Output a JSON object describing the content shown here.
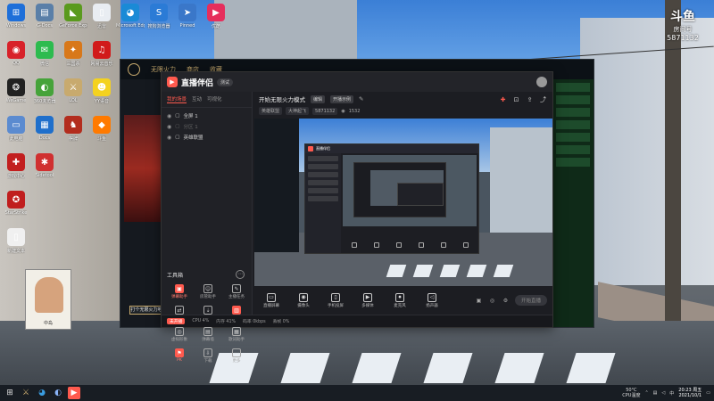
{
  "desktop": {
    "icons_col": [
      {
        "label": "Windows",
        "icon": "windows-icon",
        "color": "#1e6fd9",
        "glyph": "⊞"
      },
      {
        "label": "G-Docs",
        "icon": "docs-icon",
        "color": "#5a7fa8",
        "glyph": "▤"
      },
      {
        "label": "GeForce Experience",
        "icon": "nvidia-icon",
        "color": "#5a9a1e",
        "glyph": "◣"
      },
      {
        "label": "迅雷",
        "icon": "file-icon",
        "color": "#e9edf2",
        "glyph": "▯"
      },
      {
        "label": "QQ",
        "icon": "qq-icon",
        "color": "#d8222a",
        "glyph": "◉"
      },
      {
        "label": "微信",
        "icon": "wechat-icon",
        "color": "#2dbb4f",
        "glyph": "✉"
      },
      {
        "label": "三国杀",
        "icon": "game-icon",
        "color": "#d8781a",
        "glyph": "✦"
      },
      {
        "label": "网易云音乐",
        "icon": "music-icon",
        "color": "#d11a1a",
        "glyph": "♫"
      },
      {
        "label": "WeGame",
        "icon": "wegame-icon",
        "color": "#222",
        "glyph": "❂"
      },
      {
        "label": "360浏览器",
        "icon": "browser-icon",
        "color": "#46a33a",
        "glyph": "◐"
      },
      {
        "label": "LOL",
        "icon": "lol-icon",
        "color": "#c8aa6e",
        "glyph": "⚔"
      },
      {
        "label": "YY语音",
        "icon": "yy-icon",
        "color": "#f4d21f",
        "glyph": "☻"
      },
      {
        "label": "此电脑",
        "icon": "pc-icon",
        "color": "#5b8bd0",
        "glyph": "▭"
      },
      {
        "label": "Docs",
        "icon": "docs2-icon",
        "color": "#1f6fcb",
        "glyph": "▦"
      },
      {
        "label": "棋牌",
        "icon": "chess-icon",
        "color": "#b32d1e",
        "glyph": "♞"
      },
      {
        "label": "斗鱼",
        "icon": "douyu-icon",
        "color": "#ff7a00",
        "glyph": "◆"
      },
      {
        "label": "游戏中心",
        "icon": "gamecenter-icon",
        "color": "#c21f1f",
        "glyph": "✚"
      },
      {
        "label": "Sidetool",
        "icon": "tool-icon",
        "color": "#d03030",
        "glyph": "✱"
      },
      {
        "label": "",
        "icon": "blank-icon",
        "color": "transparent",
        "glyph": ""
      },
      {
        "label": "",
        "icon": "blank-icon",
        "color": "transparent",
        "glyph": ""
      },
      {
        "label": "StarStrike",
        "icon": "star-icon",
        "color": "#c01e1e",
        "glyph": "✪"
      },
      {
        "label": "",
        "icon": "blank-icon",
        "color": "transparent",
        "glyph": ""
      },
      {
        "label": "",
        "icon": "blank-icon",
        "color": "transparent",
        "glyph": ""
      },
      {
        "label": "",
        "icon": "blank-icon",
        "color": "transparent",
        "glyph": ""
      },
      {
        "label": "新建文本",
        "icon": "text-file-icon",
        "color": "#f0f0f0",
        "glyph": "▯"
      }
    ],
    "icons_top": [
      {
        "label": "Microsoft Edge",
        "icon": "edge-icon",
        "color": "#1a8ad6",
        "glyph": "◕"
      },
      {
        "label": "搜狗浏览器",
        "icon": "sogou-icon",
        "color": "#2b7bd6",
        "glyph": "S"
      },
      {
        "label": "Pinned",
        "icon": "pin-icon",
        "color": "#3a77c9",
        "glyph": "➤"
      },
      {
        "label": "优酷",
        "icon": "youku-icon",
        "color": "#e62e5c",
        "glyph": "▶"
      }
    ],
    "badge": {
      "title": "斗鱼",
      "subtitle": "房间号",
      "room": "5871132"
    },
    "poster_text": "中岛"
  },
  "game_client": {
    "top_items": [
      "无限火力",
      "商店",
      "收藏"
    ],
    "play_button": "打个无限火力吧"
  },
  "app": {
    "title": "直播伴侣",
    "version": "测试",
    "colors": {
      "accent": "#ff5a4e"
    },
    "scene_tabs": [
      "我的场景",
      "互动",
      "可视化"
    ],
    "scenes": [
      {
        "label": "全屏 1",
        "dim": false
      },
      {
        "label": "分区 1",
        "dim": true
      },
      {
        "label": "英雄联盟",
        "dim": false
      }
    ],
    "toolbox_title": "工具箱",
    "tools": [
      {
        "label": "弹幕助手",
        "icon": "danmu-icon",
        "glyph": "▣",
        "hot": true
      },
      {
        "label": "房管助手",
        "icon": "admin-icon",
        "glyph": "☺",
        "hot": false
      },
      {
        "label": "主播任务",
        "icon": "task-icon",
        "glyph": "✎",
        "hot": false
      },
      {
        "label": "精彩连麦",
        "icon": "link-icon",
        "glyph": "⇄",
        "hot": false
      },
      {
        "label": "多人连麦",
        "icon": "multi-icon",
        "glyph": "⇣",
        "hot": false
      },
      {
        "label": "直播间",
        "icon": "room-icon",
        "glyph": "▥",
        "hot": true
      },
      {
        "label": "虚拟形象",
        "icon": "avatar-icon",
        "glyph": "◎",
        "hot": false
      },
      {
        "label": "弹幕墙",
        "icon": "wall-icon",
        "glyph": "▤",
        "hot": false
      },
      {
        "label": "歌词助手",
        "icon": "lyric-icon",
        "glyph": "▦",
        "hot": false
      },
      {
        "label": "PK",
        "icon": "pk-icon",
        "glyph": "⚑",
        "hot": true
      },
      {
        "label": "下载",
        "icon": "download-icon",
        "glyph": "⇩",
        "hot": false
      },
      {
        "label": "更多",
        "icon": "more-icon",
        "glyph": "⋯",
        "hot": false
      }
    ],
    "header": {
      "title": "开始无限火力模式",
      "tag": "编辑",
      "mode": "开播示例",
      "chips": [
        "英雄联盟",
        "大神起飞",
        "5871132"
      ],
      "count": "1532"
    },
    "controls": [
      {
        "label": "直播屏幕",
        "icon": "screen-icon",
        "glyph": "▭"
      },
      {
        "label": "摄像头",
        "icon": "camera-icon",
        "glyph": "◉"
      },
      {
        "label": "手机投屏",
        "icon": "phone-icon",
        "glyph": "▯"
      },
      {
        "label": "多媒体",
        "icon": "media-icon",
        "glyph": "▶"
      },
      {
        "label": "麦克风",
        "icon": "mic-icon",
        "glyph": "⏺"
      },
      {
        "label": "扬声器",
        "icon": "speaker-icon",
        "glyph": "◁"
      }
    ],
    "go_live_label": "开始直播",
    "status": {
      "pill": "未开播",
      "items": [
        "CPU 4%",
        "内存 41%",
        "码率 0kbps",
        "丢帧 0%"
      ]
    }
  },
  "taskbar": {
    "tray_temp": "50°C",
    "tray_cpu": "CPU温度",
    "time": "20:23 周五",
    "date": "2021/10/1"
  }
}
